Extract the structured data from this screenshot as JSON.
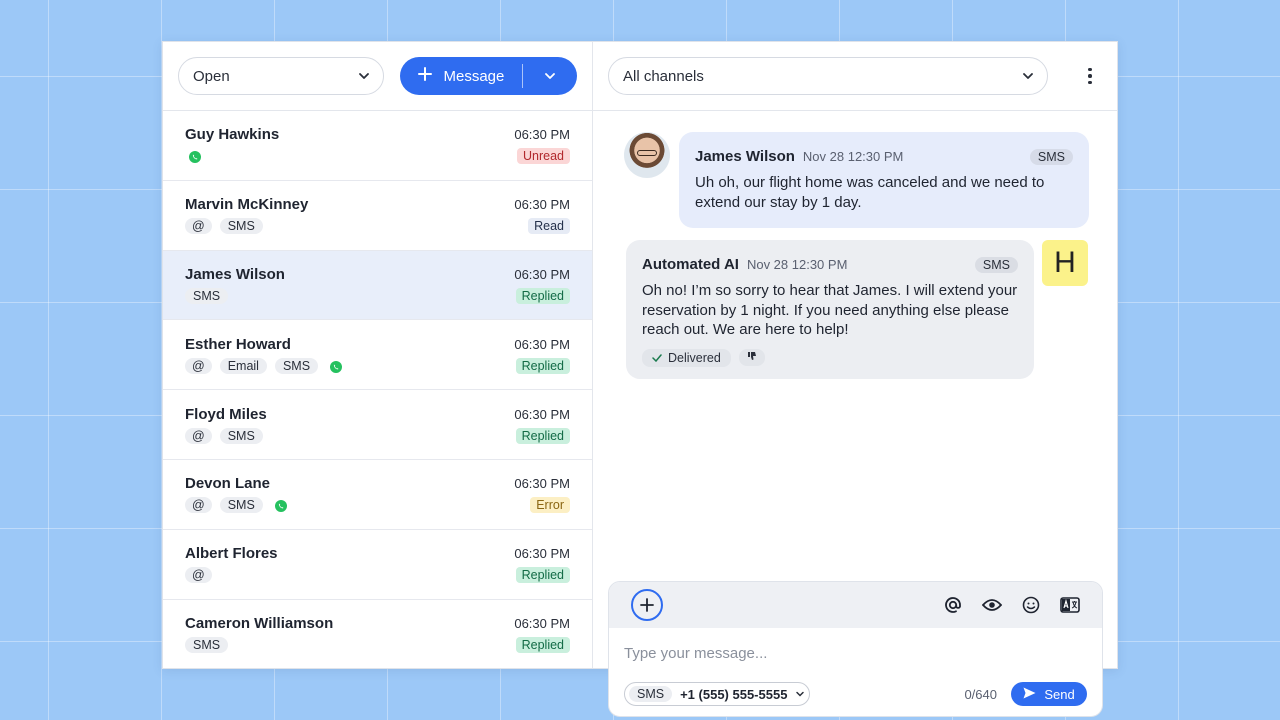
{
  "left": {
    "status_filter": "Open",
    "new_message_label": "Message"
  },
  "conversations": [
    {
      "name": "Guy Hawkins",
      "time": "06:30 PM",
      "status": "Unread",
      "status_class": "unread",
      "tags": [],
      "whatsapp": true
    },
    {
      "name": "Marvin McKinney",
      "time": "06:30 PM",
      "status": "Read",
      "status_class": "read",
      "tags": [
        "@",
        "SMS"
      ],
      "whatsapp": false
    },
    {
      "name": "James Wilson",
      "time": "06:30 PM",
      "status": "Replied",
      "status_class": "replied",
      "tags": [
        "SMS"
      ],
      "whatsapp": false,
      "active": true
    },
    {
      "name": "Esther Howard",
      "time": "06:30 PM",
      "status": "Replied",
      "status_class": "replied",
      "tags": [
        "@",
        "Email",
        "SMS"
      ],
      "whatsapp": true
    },
    {
      "name": "Floyd Miles",
      "time": "06:30 PM",
      "status": "Replied",
      "status_class": "replied",
      "tags": [
        "@",
        "SMS"
      ],
      "whatsapp": false
    },
    {
      "name": "Devon Lane",
      "time": "06:30 PM",
      "status": "Error",
      "status_class": "error",
      "tags": [
        "@",
        "SMS"
      ],
      "whatsapp": true
    },
    {
      "name": "Albert Flores",
      "time": "06:30 PM",
      "status": "Replied",
      "status_class": "replied",
      "tags": [
        "@"
      ],
      "whatsapp": false
    },
    {
      "name": "Cameron Williamson",
      "time": "06:30 PM",
      "status": "Replied",
      "status_class": "replied",
      "tags": [
        "SMS"
      ],
      "whatsapp": false
    }
  ],
  "right": {
    "channel_filter": "All channels"
  },
  "thread": {
    "incoming": {
      "sender": "James Wilson",
      "time": "Nov 28 12:30 PM",
      "channel": "SMS",
      "text": "Uh oh, our flight home was canceled and we need to extend our stay by 1 day."
    },
    "outgoing": {
      "sender": "Automated AI",
      "time": "Nov 28 12:30 PM",
      "channel": "SMS",
      "text": "Oh no! I’m so sorry to hear that James. I will extend your reservation by 1 night. If you need anything else please reach out. We are here to help!",
      "delivered_label": "Delivered",
      "avatar_initial": "H"
    }
  },
  "composer": {
    "placeholder": "Type your message...",
    "channel": "SMS",
    "phone": "+1 (555) 555-5555",
    "counter": "0/640",
    "send_label": "Send"
  },
  "colors": {
    "accent": "#2f6cf0",
    "whatsapp": "#25c15f"
  }
}
